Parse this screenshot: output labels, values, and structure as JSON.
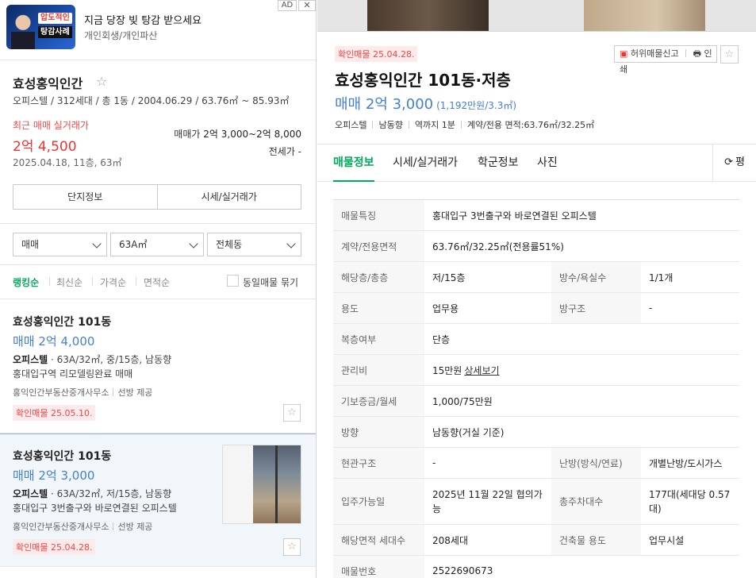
{
  "ad": {
    "thumb_tag": "압도적인",
    "thumb_tag2": "탕감사례",
    "title": "지금 당장 빚 탕감 받으세요",
    "subtitle": "개인회생/개인파산",
    "badge": "AD",
    "close": "✕"
  },
  "complex": {
    "name": "효성홍익인간",
    "star": "☆",
    "info": "오피스텔 / 312세대 / 총 1동 / 2004.06.29 / 63.76㎡ ~ 85.93㎡",
    "recent_label": "최근 매매 실거래가",
    "recent_price": "2억 4,500",
    "recent_date": "2025.04.18, 11층, 63㎡",
    "sale_label": "매매가",
    "sale_range": "2억 3,000~2억 8,000",
    "jeonse": "전세가 -",
    "btn_info": "단지정보",
    "btn_price": "시세/실거래가"
  },
  "filters": {
    "trade": "매매",
    "area": "63A㎡",
    "dong": "전체동"
  },
  "sorts": {
    "ranking": "랭킹순",
    "latest": "최신순",
    "price": "가격순",
    "area": "면적순",
    "same_label": "동일매물 묶기"
  },
  "listings": [
    {
      "name": "효성홍익인간 101동",
      "price": "매매 2억 4,000",
      "type": "오피스텔",
      "spec": " · 63A/32㎡, 중/15층, 남동향",
      "desc": "홍대입구역 리모델링완료 매매",
      "agent": "홍익인간부동산중개사무소",
      "provider": "선방 제공",
      "badge": "확인매물 25.05.10.",
      "fav": "☆"
    },
    {
      "name": "효성홍익인간 101동",
      "price": "매매 2억 3,000",
      "type": "오피스텔",
      "spec": " · 63A/32㎡, 저/15층, 남동향",
      "desc": "홍대입구 3번출구와 바로연결된 오피스텔",
      "agent": "홍익인간부동산중개사무소",
      "provider": "선방 제공",
      "badge": "확인매물 25.04.28.",
      "fav": "☆"
    }
  ],
  "article": {
    "badge": "확인매물 25.04.28.",
    "report": "허위매물신고",
    "print": "인쇄",
    "fav": "☆",
    "title": "효성홍익인간 101동·저층",
    "price": "매매 2억 3,000",
    "price_per": "(1,192만원/3.3㎡)",
    "tags": [
      "오피스텔",
      "남동향",
      "역까지 1분",
      "계약/전용 면적:63.76㎡/32.25㎡"
    ]
  },
  "tabs": {
    "info": "매물정보",
    "price": "시세/실거래가",
    "school": "학군정보",
    "photo": "사진",
    "unit": "평"
  },
  "details": {
    "feature_k": "매물특징",
    "feature_v": "홍대입구 3번출구와 바로연결된 오피스텔",
    "area_k": "계약/전용면적",
    "area_v": "63.76㎡/32.25㎡(전용률51%)",
    "floor_k": "해당층/총층",
    "floor_v": "저/15층",
    "rooms_k": "방수/욕실수",
    "rooms_v": "1/1개",
    "use_k": "용도",
    "use_v": "업무용",
    "struct_k": "방구조",
    "struct_v": "-",
    "duplex_k": "복층여부",
    "duplex_v": "단층",
    "fee_k": "관리비",
    "fee_v": "15만원",
    "fee_link": "상세보기",
    "deposit_k": "기보증금/월세",
    "deposit_v": "1,000/75만원",
    "dir_k": "방향",
    "dir_v": "남동향(거실 기준)",
    "entry_k": "현관구조",
    "entry_v": "-",
    "heat_k": "난방(방식/연료)",
    "heat_v": "개별난방/도시가스",
    "move_k": "입주가능일",
    "move_v": "2025년 11월 22일 협의가능",
    "park_k": "총주차대수",
    "park_v": "177대(세대당 0.57대)",
    "units_k": "해당면적 세대수",
    "units_v": "208세대",
    "bldg_k": "건축물 용도",
    "bldg_v": "업무시설",
    "no_k": "매물번호",
    "no_v": "2522690673"
  },
  "colors": {
    "accent": "#03a95a",
    "price": "#4480d1",
    "red": "#f14848"
  }
}
